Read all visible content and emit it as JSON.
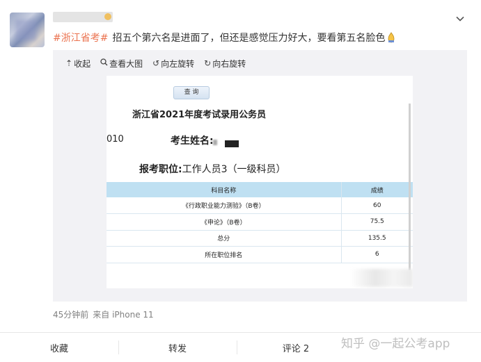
{
  "post": {
    "hashtag": "#浙江省考#",
    "text": "招五个第六名是进面了，但还是感觉压力好大，要看第五名脸色",
    "emoji": "folded-hands-emoji",
    "meta_time": "45分钟前",
    "meta_source": "来自 iPhone 11"
  },
  "media_toolbar": {
    "collapse": "收起",
    "view_large": "查看大图",
    "rotate_left": "向左旋转",
    "rotate_right": "向右旋转"
  },
  "photo": {
    "query_button": "查 询",
    "title": "浙江省2021年度考试录用公务员",
    "id_fragment": "010",
    "name_label": "考生姓名:",
    "position_label": "报考职位:",
    "position_value": "工作人员3（一级科员）",
    "table": {
      "headers": [
        "科目名称",
        "成绩"
      ],
      "rows": [
        [
          "《行政职业能力测验》（B卷）",
          "60"
        ],
        [
          "《申论》（B卷）",
          "75.5"
        ],
        [
          "总分",
          "135.5"
        ],
        [
          "所在职位排名",
          "6"
        ]
      ]
    }
  },
  "actions": {
    "favorite": "收藏",
    "repost": "转发",
    "comment": "评论 2"
  },
  "watermark": "知乎 @一起公考app",
  "colors": {
    "hashtag": "#eb7350",
    "table_header": "#bfe0f2",
    "media_bg": "#f2f2f5"
  }
}
